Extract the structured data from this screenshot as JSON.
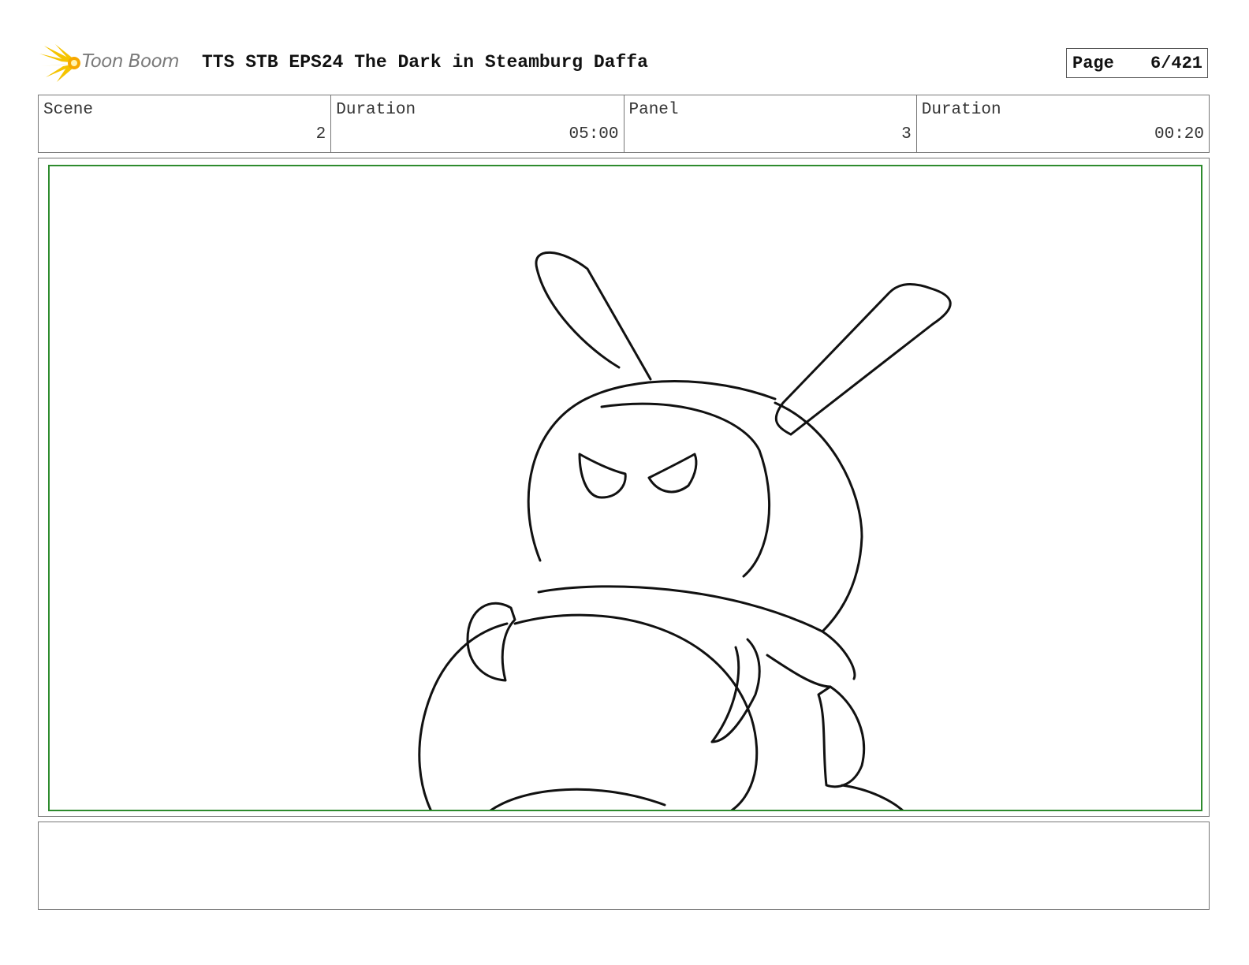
{
  "header": {
    "logo_text": "Toon Boom",
    "title": "TTS STB EPS24 The Dark in Steamburg Daffa",
    "page_label": "Page",
    "page_value": "6/421"
  },
  "info": {
    "scene_label": "Scene",
    "scene_value": "2",
    "scene_duration_label": "Duration",
    "scene_duration_value": "05:00",
    "panel_label": "Panel",
    "panel_value": "3",
    "panel_duration_label": "Duration",
    "panel_duration_value": "00:20"
  },
  "colors": {
    "safe_frame": "#2e8b2e",
    "logo_flare": "#f5c400",
    "sketch_line": "#111111"
  },
  "panel": {
    "notes": ""
  }
}
